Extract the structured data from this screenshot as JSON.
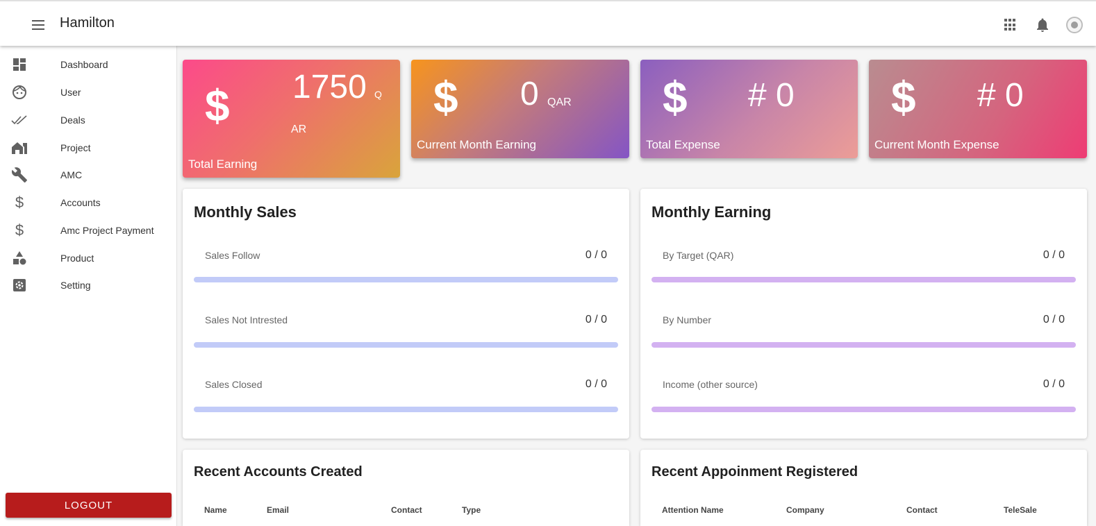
{
  "header": {
    "title": "Hamilton"
  },
  "sidebar": {
    "items": [
      {
        "label": "Dashboard",
        "icon": "dashboard-icon"
      },
      {
        "label": "User",
        "icon": "face-icon"
      },
      {
        "label": "Deals",
        "icon": "double-check-icon"
      },
      {
        "label": "Project",
        "icon": "house-icon"
      },
      {
        "label": "AMC",
        "icon": "wrench-icon"
      },
      {
        "label": "Accounts",
        "icon": "dollar-icon"
      },
      {
        "label": "Amc Project Payment",
        "icon": "dollar-icon"
      },
      {
        "label": "Product",
        "icon": "shapes-icon"
      },
      {
        "label": "Setting",
        "icon": "gear-icon"
      }
    ],
    "logout_label": "LOGOUT"
  },
  "stats": [
    {
      "symbol": "$",
      "value": "1750",
      "unit_top": "Q",
      "unit_bottom": "AR",
      "caption": "Total Earning"
    },
    {
      "symbol": "$",
      "value": "0",
      "unit": "QAR",
      "caption": "Current Month Earning"
    },
    {
      "symbol": "$",
      "value": "# 0",
      "caption": "Total Expense"
    },
    {
      "symbol": "$",
      "value": "# 0",
      "caption": "Current Month Expense"
    }
  ],
  "monthly_sales": {
    "title": "Monthly Sales",
    "rows": [
      {
        "label": "Sales Follow",
        "value": "0 / 0",
        "progress": 0
      },
      {
        "label": "Sales Not Intrested",
        "value": "0 / 0",
        "progress": 0
      },
      {
        "label": "Sales Closed",
        "value": "0 / 0",
        "progress": 0
      }
    ]
  },
  "monthly_earning": {
    "title": "Monthly Earning",
    "rows": [
      {
        "label": "By Target (QAR)",
        "value": "0 / 0",
        "progress": 0
      },
      {
        "label": "By Number",
        "value": "0 / 0",
        "progress": 0
      },
      {
        "label": "Income (other source)",
        "value": "0 / 0",
        "progress": 0
      }
    ]
  },
  "recent_accounts": {
    "title": "Recent Accounts Created",
    "columns": [
      "Name",
      "Email",
      "Contact",
      "Type"
    ]
  },
  "recent_appointments": {
    "title": "Recent Appoinment Registered",
    "columns": [
      "Attention Name",
      "Company",
      "Contact",
      "TeleSale"
    ]
  },
  "colors": {
    "logout": "#b71c1c",
    "sales_bar": "#c2cbf8",
    "earning_bar": "#d3b1f1"
  }
}
